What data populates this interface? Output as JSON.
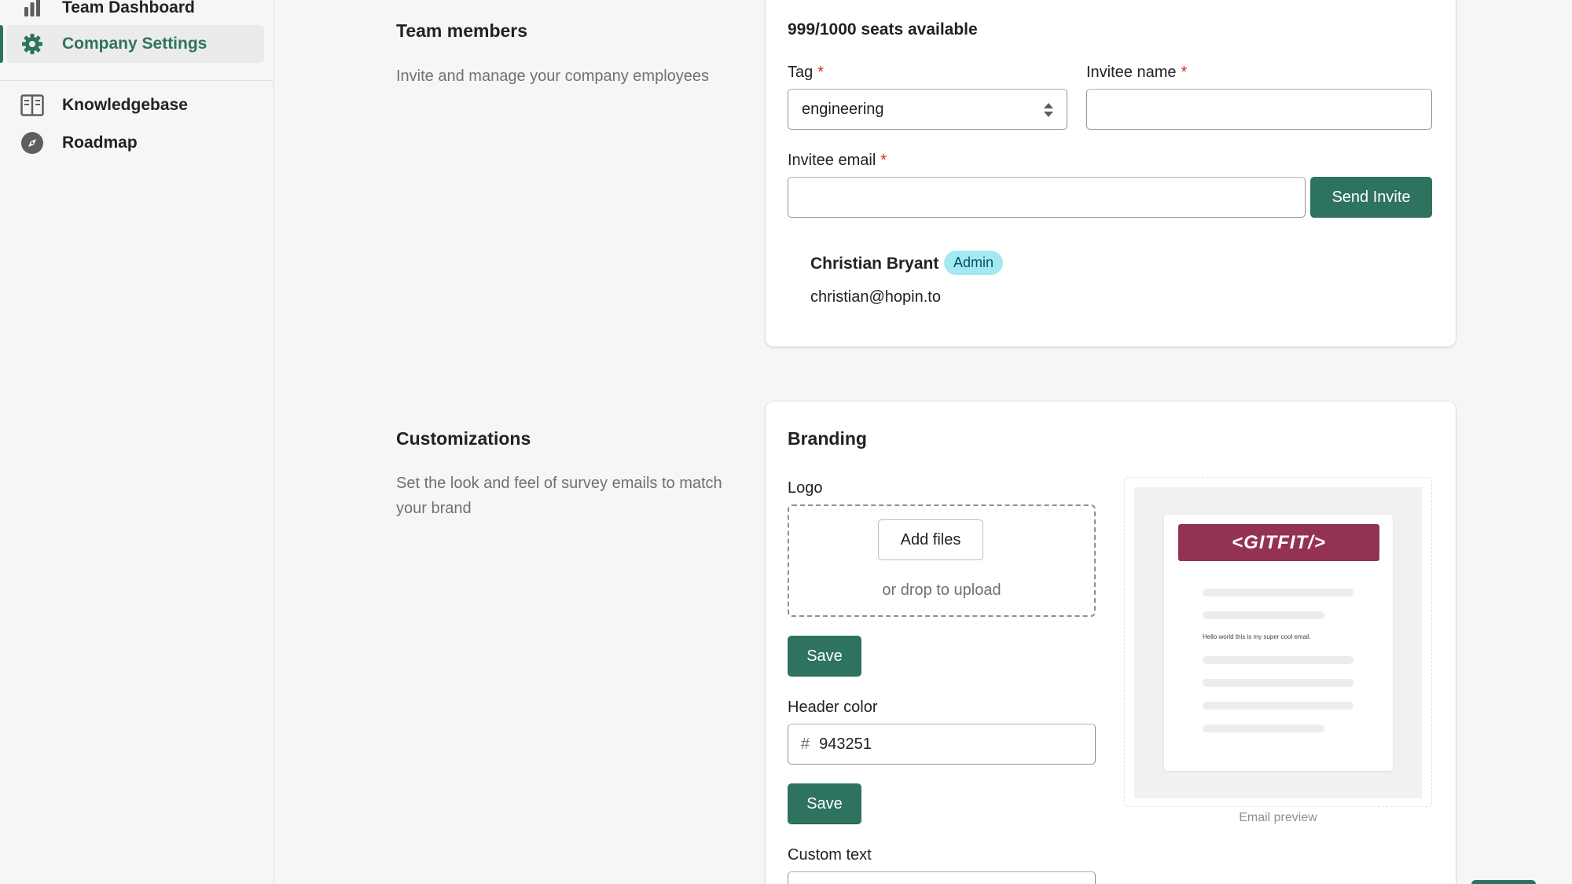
{
  "sidebar": {
    "items": [
      {
        "label": "Team Dashboard",
        "icon": "bar-chart-icon"
      },
      {
        "label": "Company Settings",
        "icon": "gear-icon",
        "active": true
      },
      {
        "label": "Knowledgebase",
        "icon": "book-icon"
      },
      {
        "label": "Roadmap",
        "icon": "compass-icon"
      }
    ]
  },
  "team_members": {
    "title": "Team members",
    "description": "Invite and manage your company employees",
    "seats": "999/1000 seats available",
    "tag_label": "Tag",
    "tag_value": "engineering",
    "invitee_name_label": "Invitee name",
    "invitee_name_value": "",
    "invitee_email_label": "Invitee email",
    "invitee_email_value": "",
    "required_marker": "*",
    "send_invite_label": "Send Invite",
    "member": {
      "name": "Christian Bryant",
      "badge": "Admin",
      "email": "christian@hopin.to"
    }
  },
  "customizations": {
    "title": "Customizations",
    "description": "Set the look and feel of survey emails to match your brand",
    "branding_title": "Branding",
    "logo_label": "Logo",
    "add_files_label": "Add files",
    "drop_hint": "or drop to upload",
    "save_label": "Save",
    "header_color_label": "Header color",
    "header_color_prefix": "#",
    "header_color_value": "943251",
    "custom_text_label": "Custom text",
    "preview": {
      "logo_text": "<GITFIT/>",
      "body_text": "Hello world this is my super cool email.",
      "caption": "Email preview",
      "header_color": "#943251"
    }
  },
  "colors": {
    "accent": "#2e7360",
    "badge_bg": "#a4e8f2",
    "required": "#d72c0d"
  }
}
